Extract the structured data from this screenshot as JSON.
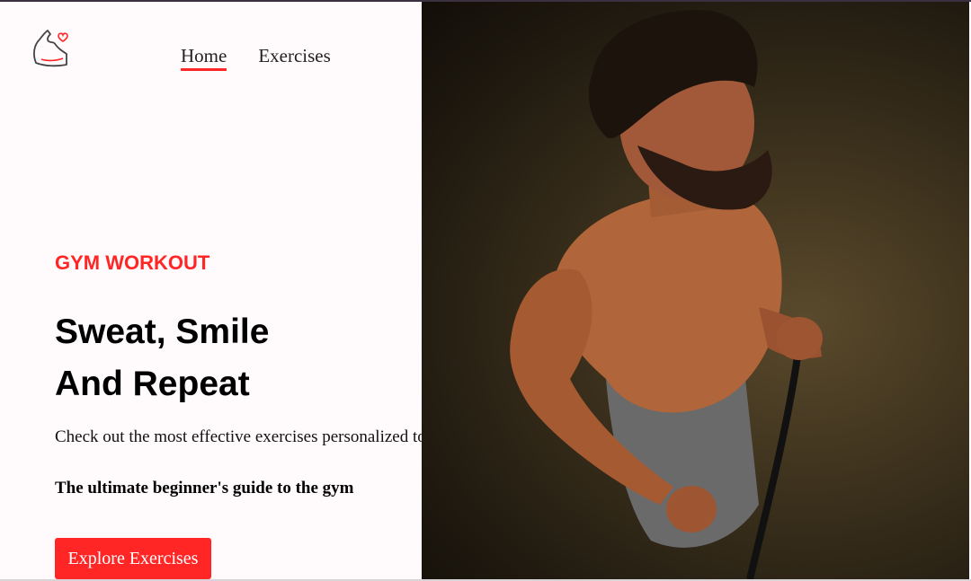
{
  "nav": {
    "logo_icon": "flexed-arm-heart-icon",
    "home_label": "Home",
    "exercises_label": "Exercises"
  },
  "hero": {
    "eyebrow": "GYM WORKOUT",
    "headline_line1": "Sweat, Smile",
    "headline_line2": "And Repeat",
    "description": "Check out the most effective exercises personalized to you",
    "guide": "The ultimate beginner's guide to the gym",
    "cta_label": "Explore Exercises",
    "image_subject": "man-training-with-resistance-band"
  },
  "colors": {
    "accent": "#ff2625",
    "background": "#fffafb"
  }
}
